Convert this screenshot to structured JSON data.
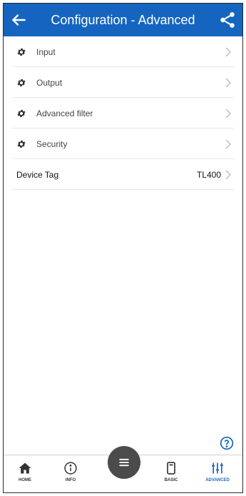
{
  "theme": {
    "primary": "#1565c0"
  },
  "appbar": {
    "title": "Configuration - Advanced",
    "back_icon": "arrow-left-icon",
    "share_icon": "share-icon"
  },
  "menu": [
    {
      "label": "Input",
      "icon": "gear-icon"
    },
    {
      "label": "Output",
      "icon": "gear-icon"
    },
    {
      "label": "Advanced filter",
      "icon": "gear-icon"
    },
    {
      "label": "Security",
      "icon": "gear-icon"
    }
  ],
  "device_tag": {
    "label": "Device Tag",
    "value": "TL400"
  },
  "help_icon": "help-circle-icon",
  "bottom_nav": [
    {
      "label": "HOME",
      "icon": "home-icon"
    },
    {
      "label": "INFO",
      "icon": "info-icon"
    },
    {
      "label": "",
      "icon": "menu-icon"
    },
    {
      "label": "BASIC",
      "icon": "device-icon"
    },
    {
      "label": "ADVANCED",
      "icon": "sliders-icon",
      "active": true
    }
  ]
}
